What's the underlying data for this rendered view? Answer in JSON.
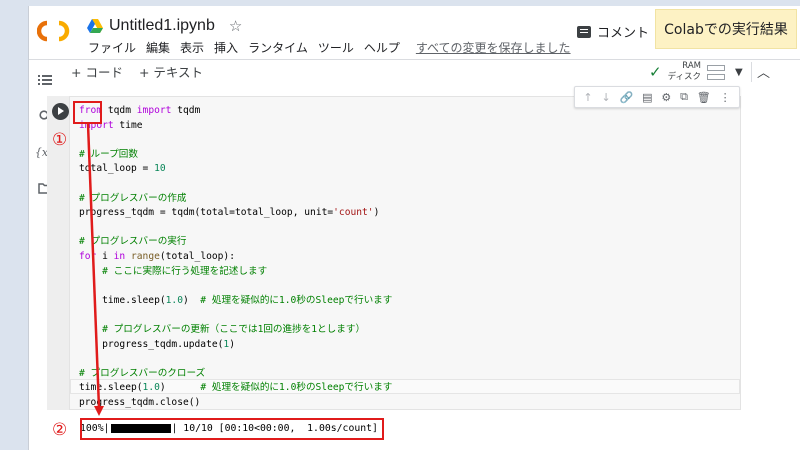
{
  "header": {
    "logo": "CO",
    "title": "Untitled1.ipynb",
    "star_icon": "☆",
    "comment_label": "コメント",
    "menu": [
      "ファイル",
      "編集",
      "表示",
      "挿入",
      "ランタイム",
      "ツール",
      "ヘルプ"
    ],
    "saved_status": "すべての変更を保存しました"
  },
  "annotation": {
    "label": "Colabでの実行結果",
    "marker1": "①",
    "marker2": "②",
    "color": "#e01b1b"
  },
  "toolbar": {
    "add_code": "+ コード",
    "add_text": "+ テキスト",
    "ram_label": "RAM",
    "disk_label": "ディスク"
  },
  "rail_icons": [
    "list-icon",
    "search-icon",
    "variables-icon",
    "folder-icon"
  ],
  "cell_tools": [
    "↑",
    "↓",
    "🔗",
    "▤",
    "⚙",
    "⧉",
    "🗑",
    "⋮"
  ],
  "code_lines": [
    "from tqdm import tqdm",
    "import time",
    "",
    "# ループ回数",
    "total_loop = 10",
    "",
    "# プログレスバーの作成",
    "progress_tqdm = tqdm(total=total_loop, unit='count')",
    "",
    "# プログレスバーの実行",
    "for i in range(total_loop):",
    "    # ここに実際に行う処理を記述します",
    "",
    "    time.sleep(1.0)  # 処理を疑似的に1.0秒のSleepで行います",
    "",
    "    # プログレスバーの更新（ここでは1回の進捗を1とします）",
    "    progress_tqdm.update(1)",
    "",
    "# プログレスバーのクローズ",
    "time.sleep(1.0)      # 処理を疑似的に1.0秒のSleepで行います",
    "progress_tqdm.close()"
  ],
  "output": {
    "prefix": "100%|",
    "suffix": "| 10/10 [00:10<00:00,  1.00s/count]",
    "progress": 1.0
  }
}
